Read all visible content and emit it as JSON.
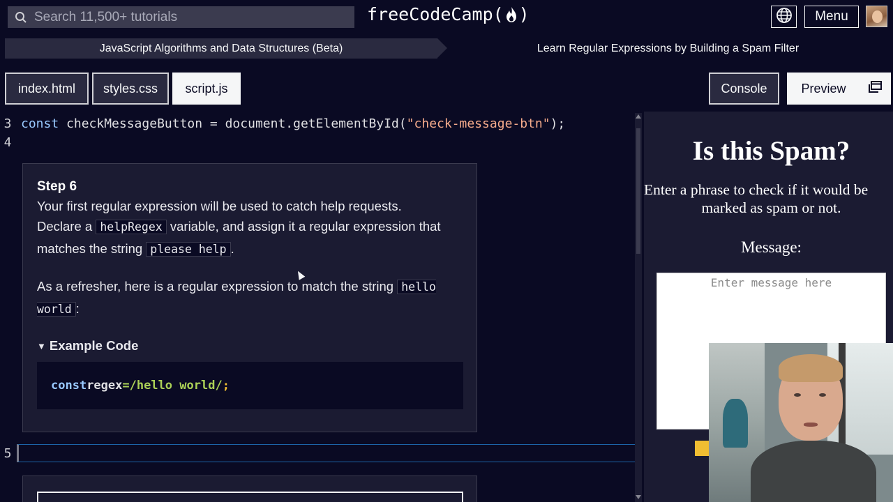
{
  "nav": {
    "search_placeholder": "Search 11,500+ tutorials",
    "logo_left": "freeCodeCamp(",
    "logo_right": ")",
    "menu_label": "Menu"
  },
  "breadcrumb": {
    "course": "JavaScript Algorithms and Data Structures (Beta)",
    "project": "Learn Regular Expressions by Building a Spam Filter"
  },
  "tabs": {
    "files": [
      "index.html",
      "styles.css",
      "script.js"
    ],
    "active_file": "script.js",
    "console": "Console",
    "preview": "Preview"
  },
  "editor": {
    "line3": {
      "number": "3",
      "kw": "const",
      "text1": " checkMessageButton = document.getElementById(",
      "str": "\"check-message-btn\"",
      "text2": ");"
    },
    "line4": {
      "number": "4"
    },
    "line5": {
      "number": "5"
    }
  },
  "step": {
    "title": "Step 6",
    "p1": "Your first regular expression will be used to catch help requests.",
    "p2_a": "Declare a ",
    "p2_code1": "helpRegex",
    "p2_b": " variable, and assign it a regular expression that matches the string ",
    "p2_code2": "please help",
    "p2_c": ".",
    "p3_a": "As a refresher, here is a regular expression to match the string ",
    "p3_code": "hello world",
    "p3_b": ":",
    "summary": "Example Code",
    "example": {
      "kw": "const",
      "var": " regex ",
      "op": "= ",
      "re": "/hello world/",
      "semi": ";"
    }
  },
  "preview": {
    "title": "Is this Spam?",
    "subtitle_line1": "Enter a phrase to check if it would be",
    "subtitle_line2": "marked as spam or not.",
    "label": "Message:",
    "textarea_placeholder": "Enter message here"
  }
}
